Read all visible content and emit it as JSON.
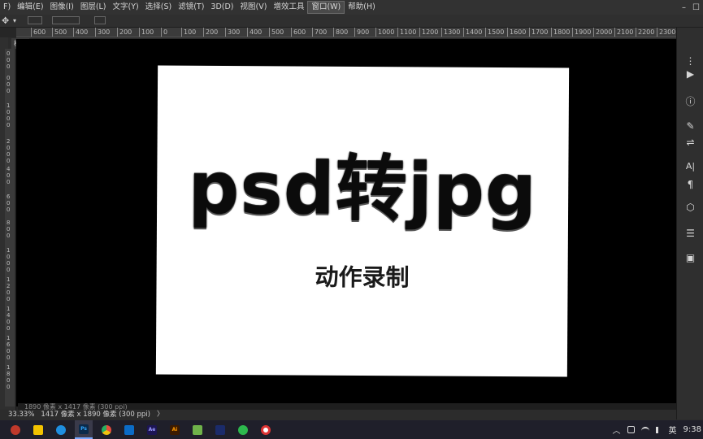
{
  "menubar": {
    "items": [
      "F)",
      "编辑(E)",
      "图像(I)",
      "图层(L)",
      "文字(Y)",
      "选择(S)",
      "滤镜(T)",
      "3D(D)",
      "视图(V)",
      "增效工具",
      "窗口(W)",
      "帮助(H)"
    ],
    "active_index": 10,
    "win_min": "–",
    "win_restore": "☐"
  },
  "options": {
    "move_icon": "✥",
    "dropdown_icon": "▾"
  },
  "ruler_h": [
    "600",
    "500",
    "400",
    "300",
    "200",
    "100",
    "0",
    "100",
    "200",
    "300",
    "400",
    "500",
    "600",
    "700",
    "800",
    "900",
    "1000",
    "1100",
    "1200",
    "1300",
    "1400",
    "1500",
    "1600",
    "1700",
    "1800",
    "1900",
    "2000",
    "2100",
    "2200",
    "2300"
  ],
  "ruler_v": [
    "0",
    "0",
    "0",
    "0",
    "0",
    "0",
    "1",
    "0",
    "0",
    "0",
    "2",
    "0",
    "0",
    "0",
    "4",
    "0",
    "0",
    "6",
    "0",
    "0",
    "8",
    "0",
    "0",
    "1",
    "0",
    "0",
    "0",
    "1",
    "2",
    "0",
    "0",
    "1",
    "4",
    "0",
    "0",
    "1",
    "6",
    "0",
    "0",
    "1",
    "8",
    "0",
    "0"
  ],
  "tab": {
    "label": "模板"
  },
  "document": {
    "headline": "psd转jpg",
    "subtitle": "动作录制"
  },
  "docinfo": {
    "text": "1890 像素 x 1417 像素 (300 ppi)"
  },
  "status": {
    "zoom": "33.33%",
    "info": "1417 像素 x 1890 像素 (300 ppi)",
    "arrow": "〉"
  },
  "rightpanel": {
    "icons": [
      "⋮",
      "▶",
      "ⓘ",
      "✎",
      "⇌",
      "A|",
      "¶",
      "⬡",
      "☰",
      "▣"
    ]
  },
  "taskbar": {
    "apps": [
      {
        "name": "widgets-icon",
        "label": "",
        "color": "#c0392b"
      },
      {
        "name": "file-explorer-icon",
        "label": "",
        "color": "#f2c200"
      },
      {
        "name": "edge-browser-icon",
        "label": "",
        "color": "#1f8fe0"
      },
      {
        "name": "photoshop-icon",
        "label": "Ps",
        "color": "#0b2a4a"
      },
      {
        "name": "chrome-icon",
        "label": "",
        "color": "#e74c3c"
      },
      {
        "name": "outlook-icon",
        "label": "",
        "color": "#0b6cc7"
      },
      {
        "name": "after-effects-icon",
        "label": "Ae",
        "color": "#1c1554"
      },
      {
        "name": "illustrator-icon",
        "label": "Ai",
        "color": "#3d1b00"
      },
      {
        "name": "notes-icon",
        "label": "",
        "color": "#6fb24a"
      },
      {
        "name": "app-icon",
        "label": "",
        "color": "#1b2b6a"
      },
      {
        "name": "wechat-icon",
        "label": "",
        "color": "#2db84d"
      },
      {
        "name": "record-icon",
        "label": "",
        "color": "#d33"
      }
    ],
    "active_index": 3
  },
  "tray": {
    "chevron": "︿",
    "ime": "英",
    "time": "9:38"
  }
}
